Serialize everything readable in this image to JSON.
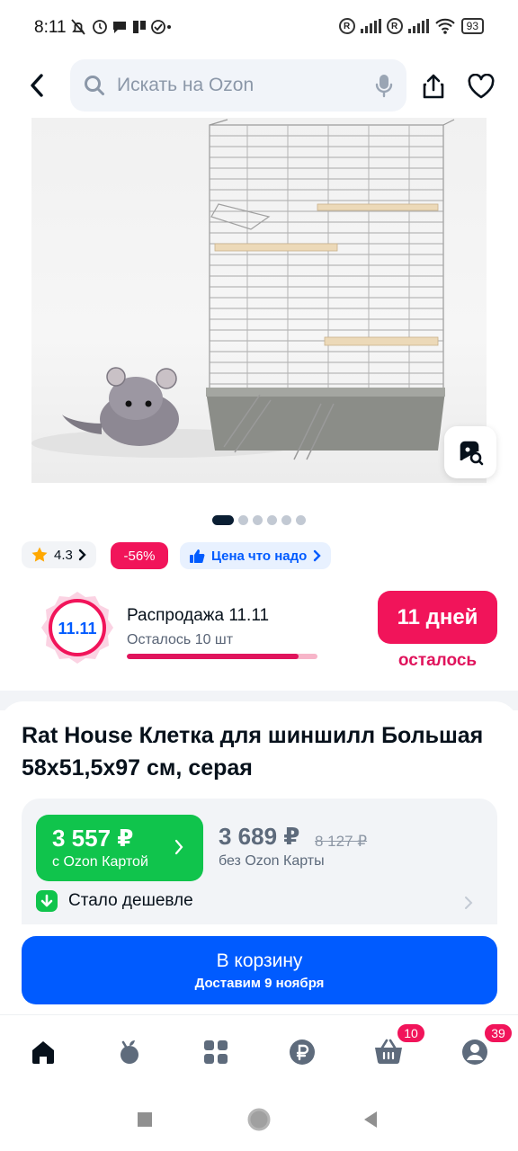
{
  "status_bar": {
    "time": "8:11",
    "battery": "93"
  },
  "header": {
    "search_placeholder": "Искать на Ozon"
  },
  "gallery": {
    "image_count": 6,
    "active_index": 0
  },
  "badges": {
    "rating": "4.3",
    "discount": "-56%",
    "good_price": "Цена что надо"
  },
  "sale": {
    "logo_text": "11.11",
    "title": "Распродажа 11.11",
    "remaining": "Осталось 10 шт",
    "stock_fraction": 0.9,
    "days_label": "11 дней",
    "days_sub": "осталось"
  },
  "product": {
    "title": "Rat House Клетка для шиншилл Большая 58x51,5x97 см, серая"
  },
  "price": {
    "card_price": "3 557 ₽",
    "card_sub": "с Ozon Картой",
    "regular_price": "3 689 ₽",
    "old_price": "8 127 ₽",
    "regular_sub": "без Ozon Карты",
    "cheaper_label": "Стало дешевле"
  },
  "cart": {
    "label": "В корзину",
    "delivery": "Доставим 9 ноября"
  },
  "bottom_nav": {
    "items": [
      {
        "icon": "home-icon"
      },
      {
        "icon": "fresh-icon"
      },
      {
        "icon": "catalog-icon"
      },
      {
        "icon": "ruble-icon"
      },
      {
        "icon": "cart-icon",
        "badge": "10"
      },
      {
        "icon": "profile-icon",
        "badge": "39"
      }
    ]
  },
  "colors": {
    "brand_blue": "#005bff",
    "sale_pink": "#f1145a",
    "card_green": "#10c44c"
  }
}
